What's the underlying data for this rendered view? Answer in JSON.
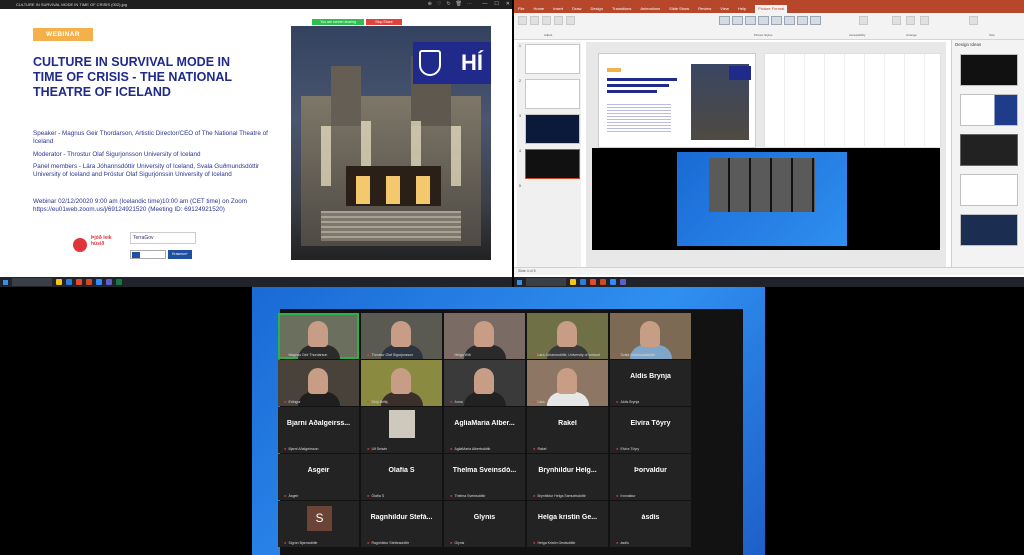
{
  "viewer": {
    "title": "CULTURE IN SURVIVAL MODE IN TIME OF CRISIS (002).jpg",
    "slide": {
      "badge": "WEBINAR",
      "title": "CULTURE IN SURVIVAL MODE IN TIME OF CRISIS  - THE NATIONAL THEATRE OF ICELAND",
      "speaker": "Speaker - Magnus Geir Thordarson, Artistic Director/CEO of The National Theatre of Iceland",
      "moderator": "Moderator - Throstur Olaf Sigurjonsson University of Iceland",
      "panel": "Panel members - Lára Jóhannsdóttir University of Iceland, Svala Guðmundsdóttir University of Iceland and Þröstur Olaf Sigurjónssin University of Iceland",
      "meeting": "Webinar 02/12/20020 9:00 am (Icelandic time)10:00 am (CET time) on Zoom https://eu01web.zoom.us/j/69124921520 (Meeting ID: 69124921520)",
      "hi_logo": "HÍ",
      "logo_theatre": "Þjóð leik húsið",
      "logo_terragov": "TerraGov",
      "logo_erasmus": "Erasmus+"
    },
    "zoom_bar": {
      "green": "You are screen sharing",
      "red": "Stop Share"
    }
  },
  "ppt": {
    "tabs": [
      "File",
      "Home",
      "Insert",
      "Draw",
      "Design",
      "Transitions",
      "Animations",
      "Slide Show",
      "Review",
      "View",
      "Help",
      "Picture Format"
    ],
    "active_tab": "Picture Format",
    "ribbon_groups": [
      "Adjust",
      "Picture Styles",
      "Accessibility",
      "Arrange",
      "Size"
    ],
    "thumb_numbers": [
      "1",
      "2",
      "3",
      "4",
      "5"
    ],
    "design_title": "Design Ideas",
    "status": "Slide 4 of 5",
    "accent": "#b7472a"
  },
  "zoom": {
    "tiles": [
      {
        "label": "Magnus Geir Thordarson",
        "big": "",
        "kind": "video",
        "shirt": "#2b2b2b",
        "bg": "#6a6f5e",
        "speaker": true
      },
      {
        "label": "Throstur Olaf Sigurjonsson",
        "big": "",
        "kind": "video",
        "shirt": "#2e3340",
        "bg": "#5a5a52"
      },
      {
        "label": "Helga Witt",
        "big": "",
        "kind": "video",
        "shirt": "#2a2a2a",
        "bg": "#7a6c64"
      },
      {
        "label": "Lára Jóhannsdóttir, University of Iceland",
        "big": "",
        "kind": "video",
        "shirt": "#3a3a3a",
        "bg": "#6f7045"
      },
      {
        "label": "Svala Guðmundsdóttir",
        "big": "",
        "kind": "video",
        "shirt": "#7fa6c8",
        "bg": "#7c6a54"
      },
      {
        "label": "Erlingur",
        "big": "",
        "kind": "video",
        "shirt": "#1f1f1f",
        "bg": "#49423b"
      },
      {
        "label": "Sirrý Brilbj.",
        "big": "",
        "kind": "video",
        "shirt": "#3a2f2a",
        "bg": "#8a8a40"
      },
      {
        "label": "Anna",
        "big": "",
        "kind": "video",
        "shirt": "#222",
        "bg": "#3a3a3a"
      },
      {
        "label": "Lára",
        "big": "",
        "kind": "video",
        "shirt": "#e6e6e6",
        "bg": "#8d7764"
      },
      {
        "label": "Aldís Brynja",
        "big": "Aldís Brynja",
        "kind": "name"
      },
      {
        "label": "Bjarni Aðalgeirsson",
        "big": "Bjarni  Aðalgeirss...",
        "kind": "name"
      },
      {
        "label": "Ulf Seiwin",
        "big": "",
        "kind": "pic"
      },
      {
        "label": "AgliaMaria Albertsdóttir",
        "big": "AgliaMaria  Alber...",
        "kind": "name"
      },
      {
        "label": "Rakel",
        "big": "Rakel",
        "kind": "name"
      },
      {
        "label": "Elvíra Töyry",
        "big": "Elvíra  Töyry",
        "kind": "name"
      },
      {
        "label": "Ásgeir",
        "big": "Ásgeir",
        "kind": "name"
      },
      {
        "label": "Ólafía S",
        "big": "Ólafía  S",
        "kind": "name"
      },
      {
        "label": "Thelma Sveinsdóttir",
        "big": "Thelma  Sveinsdó...",
        "kind": "name"
      },
      {
        "label": "Brynhildur Helga Samuelsdóttir",
        "big": "Brynhildur  Helg...",
        "kind": "name"
      },
      {
        "label": "Þorvaldur",
        "big": "Þorvaldur",
        "kind": "name"
      },
      {
        "label": "Sigrún Bjarnadóttir",
        "big": "",
        "kind": "avatar",
        "avatar": "S"
      },
      {
        "label": "Ragnhildur Stefánsdóttir",
        "big": "Ragnhildur  Stefá...",
        "kind": "name"
      },
      {
        "label": "Glynis",
        "big": "Glynis",
        "kind": "name"
      },
      {
        "label": "Helga Kristín Gestsdóttir",
        "big": "Helga  kristín  Ge...",
        "kind": "name"
      },
      {
        "label": "ásdís",
        "big": "ásdís",
        "kind": "name"
      }
    ]
  }
}
